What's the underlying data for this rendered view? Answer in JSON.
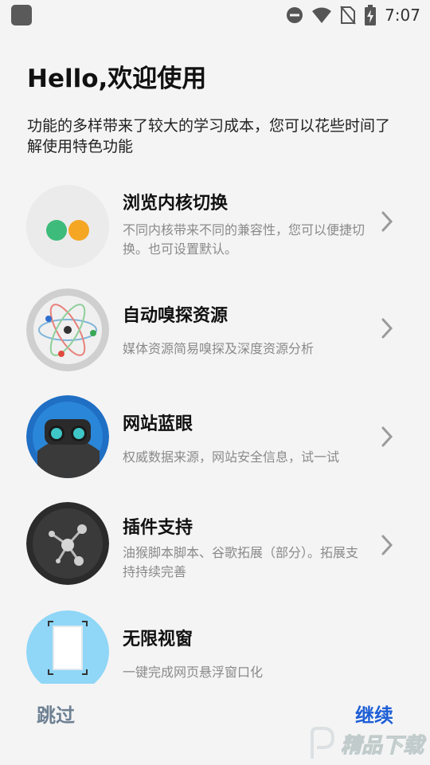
{
  "status_bar": {
    "time": "7:07"
  },
  "header": {
    "title": "Hello,欢迎使用",
    "subtitle": "功能的多样带来了较大的学习成本，您可以花些时间了解使用特色功能"
  },
  "features": [
    {
      "title": "浏览内核切换",
      "desc": "不同内核带来不同的兼容性，您可以便捷切换。也可设置默认。",
      "icon": "toggle-dots-icon"
    },
    {
      "title": "自动嗅探资源",
      "desc": "媒体资源简易嗅探及深度资源分析",
      "icon": "atom-icon"
    },
    {
      "title": "网站蓝眼",
      "desc": "权威数据来源，网站安全信息，试一试",
      "icon": "goggles-icon"
    },
    {
      "title": "插件支持",
      "desc": "油猴脚本脚本、谷歌拓展（部分）。拓展支持持续完善",
      "icon": "molecule-icon"
    },
    {
      "title": "无限视窗",
      "desc": "一键完成网页悬浮窗口化",
      "icon": "window-frame-icon"
    }
  ],
  "footer": {
    "skip": "跳过",
    "continue": "继续"
  },
  "watermark": {
    "text": "精品下载"
  },
  "colors": {
    "background": "#f4f4f4",
    "accent": "#1e5fd6",
    "muted": "#6e8193"
  }
}
